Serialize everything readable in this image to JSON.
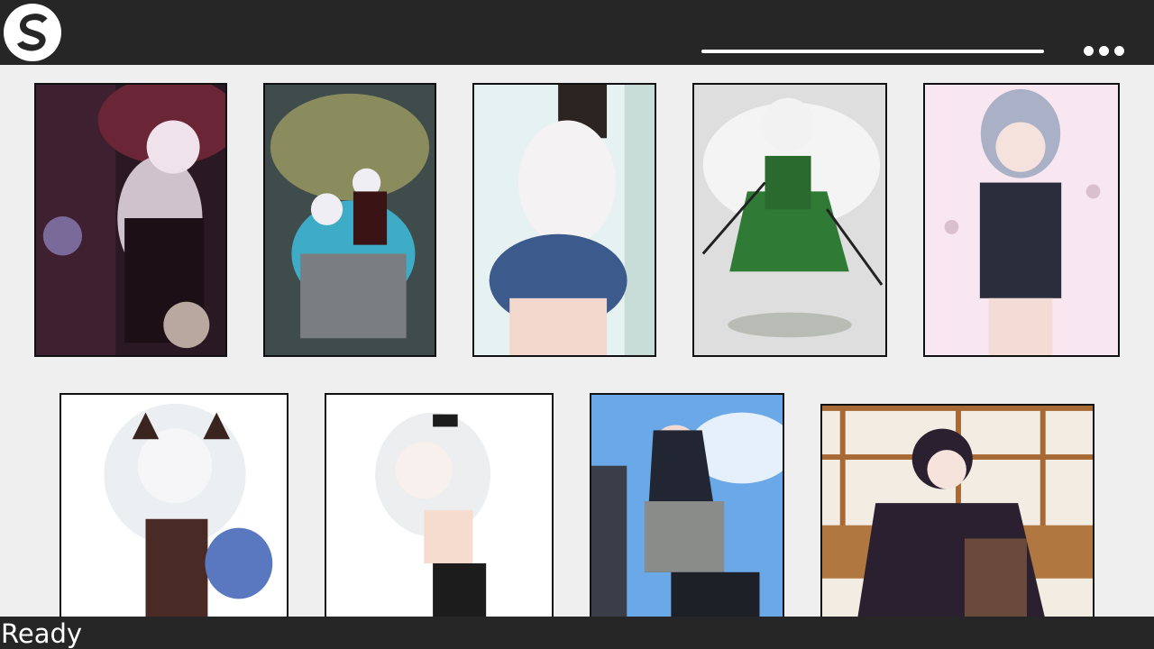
{
  "header": {
    "logo_letter": "S",
    "menu_icon": "more-dots-icon",
    "colors": {
      "bar": "#262626",
      "accent": "#ffffff"
    }
  },
  "gallery": {
    "thumbnails": [
      {
        "icon": "image-thumbnail",
        "palette": [
          "#3a1e2a",
          "#8a5a70",
          "#d8c8d0",
          "#1a1018"
        ]
      },
      {
        "icon": "image-thumbnail",
        "palette": [
          "#3e4a48",
          "#8a9060",
          "#e8e8ee",
          "#59c8e8"
        ]
      },
      {
        "icon": "image-thumbnail",
        "palette": [
          "#dfeeee",
          "#f2f2f2",
          "#3c5a8a",
          "#f0d0c0"
        ]
      },
      {
        "icon": "image-thumbnail",
        "palette": [
          "#e0e0e0",
          "#2e7a34",
          "#f4f4f4",
          "#222222"
        ]
      },
      {
        "icon": "image-thumbnail",
        "palette": [
          "#f8e8f2",
          "#2a2e3c",
          "#b0b4c8",
          "#f6dada"
        ]
      },
      {
        "icon": "image-thumbnail",
        "palette": [
          "#ffffff",
          "#eeeeee",
          "#4a2a24",
          "#5a78c0"
        ]
      },
      {
        "icon": "image-thumbnail",
        "palette": [
          "#ffffff",
          "#eeeeee",
          "#1c1c1c",
          "#f6dcd0"
        ]
      },
      {
        "icon": "image-thumbnail",
        "palette": [
          "#6aa8e8",
          "#2a2e3a",
          "#8a8a88",
          "#f0d8d0"
        ]
      },
      {
        "icon": "image-thumbnail",
        "palette": [
          "#f2ece2",
          "#a86a34",
          "#2a2030",
          "#6a4a3a"
        ]
      }
    ]
  },
  "status": {
    "text": "Ready"
  }
}
